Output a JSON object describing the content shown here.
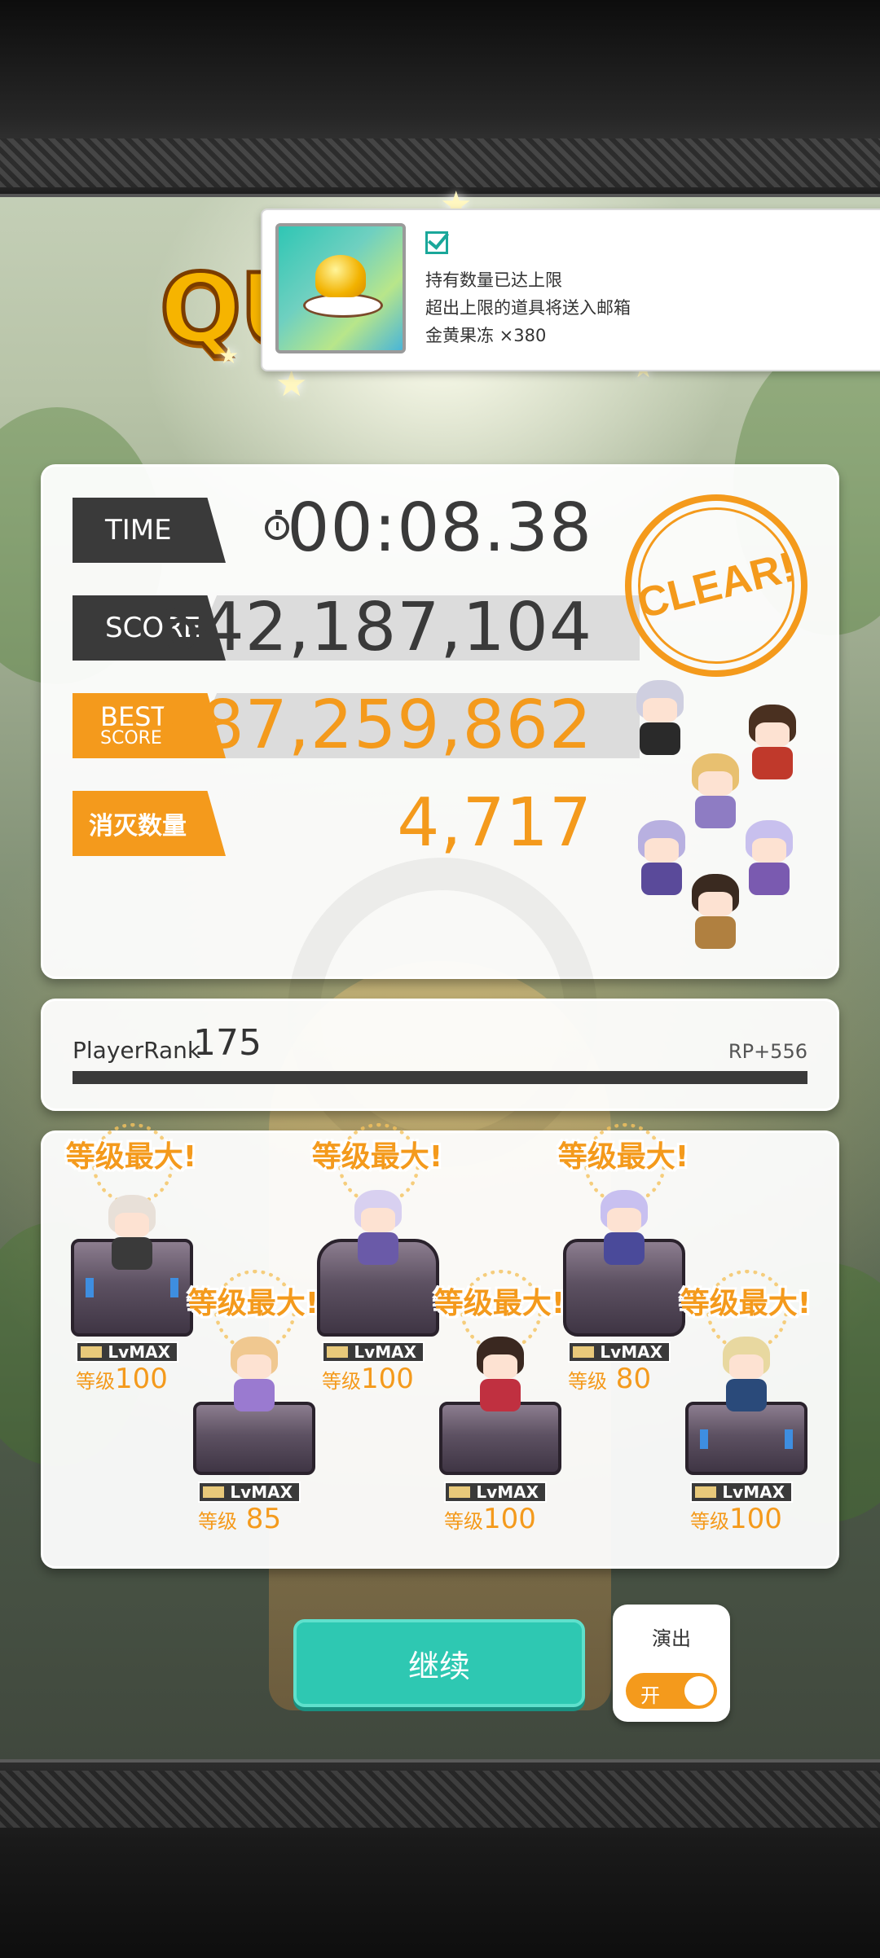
{
  "quest_title_partial": "QU",
  "notification": {
    "line1": "持有数量已达上限",
    "line2": "超出上限的道具将送入邮箱",
    "line3": "金黄果冻 ×380",
    "item_icon": "golden-pudding-icon",
    "checked": true
  },
  "result": {
    "time_label": "TIME",
    "time_value": "00:08.38",
    "score_label": "SCORE",
    "score_value": "642,187,104",
    "best_label_1": "BEST",
    "best_label_2": "SCORE",
    "best_value": "987,259,862",
    "kill_label": "消灭数量",
    "kill_value": "4,717",
    "clear_stamp": "CLEAR!"
  },
  "rank": {
    "label": "PlayerRank",
    "value": "175",
    "rp": "RP+556"
  },
  "characters": [
    {
      "max_text": "等级最大!",
      "badge": "LvMAX",
      "level_prefix": "等级",
      "level": "100"
    },
    {
      "max_text": "等级最大!",
      "badge": "LvMAX",
      "level_prefix": "等级",
      "level": " 85"
    },
    {
      "max_text": "等级最大!",
      "badge": "LvMAX",
      "level_prefix": "等级",
      "level": "100"
    },
    {
      "max_text": "等级最大!",
      "badge": "LvMAX",
      "level_prefix": "等级",
      "level": "100"
    },
    {
      "max_text": "等级最大!",
      "badge": "LvMAX",
      "level_prefix": "等级",
      "level": " 80"
    },
    {
      "max_text": "等级最大!",
      "badge": "LvMAX",
      "level_prefix": "等级",
      "level": "100"
    }
  ],
  "controls": {
    "continue_label": "继续",
    "performance_label": "演出",
    "performance_toggle": "开",
    "performance_on": true
  },
  "colors": {
    "accent_orange": "#f49a1c",
    "dark_label": "#3a3a3a",
    "continue_teal": "#2ec8b2"
  }
}
